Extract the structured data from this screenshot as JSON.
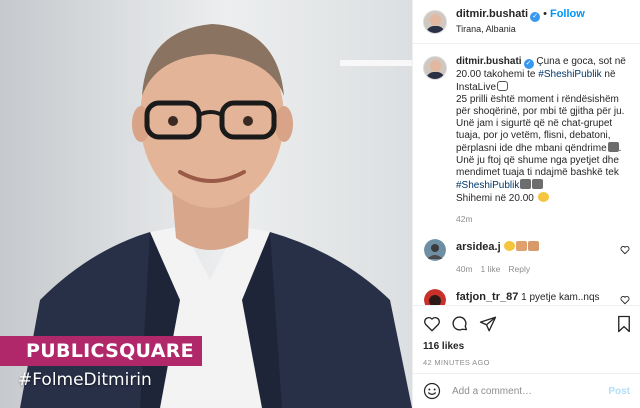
{
  "header": {
    "username": "ditmir.bushati",
    "follow_label": "Follow",
    "location": "Tirana, Albania"
  },
  "photo": {
    "brand_text": "PUBLICSQUARE",
    "hashtag_text": "#FolmeDitmirin"
  },
  "caption": {
    "username": "ditmir.bushati",
    "line1": "Çuna e goca, sot në 20.00 takohemi te ",
    "hashtag1": "#SheshiPublik",
    "line2": " në InstaLive",
    "para2": "25 prilli është moment i rëndësishëm për shoqërinë, por mbi të gjitha për ju.",
    "para3": "Unë jam i sigurtë që në chat-grupet tuaja, por jo vetëm, flisni, debatoni, përplasni ide dhe mbani qëndrime",
    "para4": "Unë ju ftoj që shume nga pyetjet dhe mendimet tuaja ti ndajmë bashkë tek ",
    "hashtag2": "#SheshiPublik",
    "para5": "Shihemi në 20.00",
    "time": "42m"
  },
  "comments": [
    {
      "username": "arsidea.j",
      "time": "40m",
      "likes": "1 like",
      "reply": "Reply"
    },
    {
      "username": "fatjon_tr_87",
      "text": "1 pyetje kam..nqs"
    }
  ],
  "actions": {
    "likes_text": "116 likes",
    "time_ago": "42 MINUTES AGO"
  },
  "add_comment": {
    "placeholder": "Add a comment…",
    "post_label": "Post"
  },
  "colors": {
    "brand_banner": "#b0286a",
    "link_blue": "#0095f6",
    "verified_blue": "#3897f0"
  }
}
